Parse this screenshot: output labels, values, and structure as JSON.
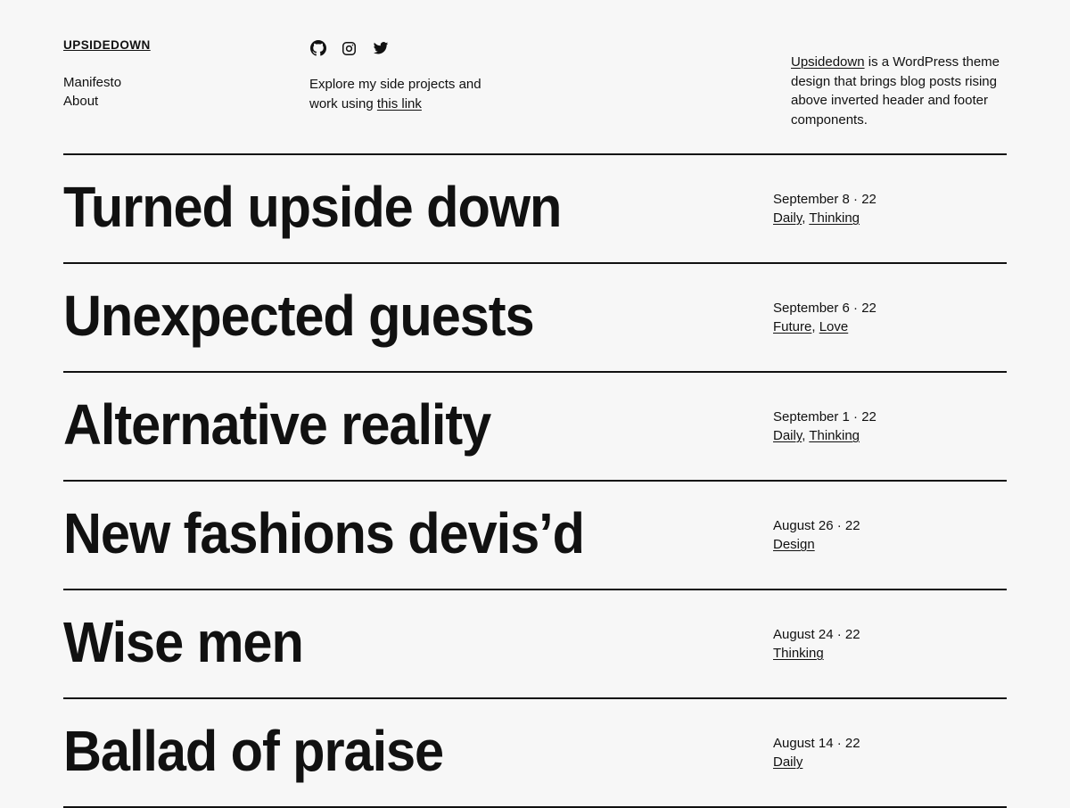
{
  "header": {
    "site_title": "UPSIDEDOWN",
    "nav": [
      {
        "label": "Manifesto"
      },
      {
        "label": "About"
      }
    ],
    "social": [
      {
        "name": "github-icon",
        "label": "GitHub"
      },
      {
        "name": "instagram-icon",
        "label": "Instagram"
      },
      {
        "name": "twitter-icon",
        "label": "Twitter"
      }
    ],
    "blurb": {
      "lead": "Explore my side projects and work using ",
      "link": "this link"
    },
    "description": {
      "link": "Upsidedown",
      "rest": " is a WordPress theme design that brings blog posts rising above inverted header and footer components."
    }
  },
  "posts": [
    {
      "title": "Turned upside down",
      "date": "September 8 · 22",
      "categories": [
        "Daily",
        "Thinking"
      ]
    },
    {
      "title": "Unexpected guests",
      "date": "September 6 · 22",
      "categories": [
        "Future",
        "Love"
      ]
    },
    {
      "title": "Alternative reality",
      "date": "September 1 · 22",
      "categories": [
        "Daily",
        "Thinking"
      ]
    },
    {
      "title": "New fashions devis’d",
      "date": "August 26 · 22",
      "categories": [
        "Design"
      ]
    },
    {
      "title": "Wise men",
      "date": "August 24 · 22",
      "categories": [
        "Thinking"
      ]
    },
    {
      "title": "Ballad of praise",
      "date": "August 14 · 22",
      "categories": [
        "Daily"
      ]
    }
  ],
  "colors": {
    "background": "#f7f7f7",
    "text": "#111111",
    "rule": "#111111"
  }
}
